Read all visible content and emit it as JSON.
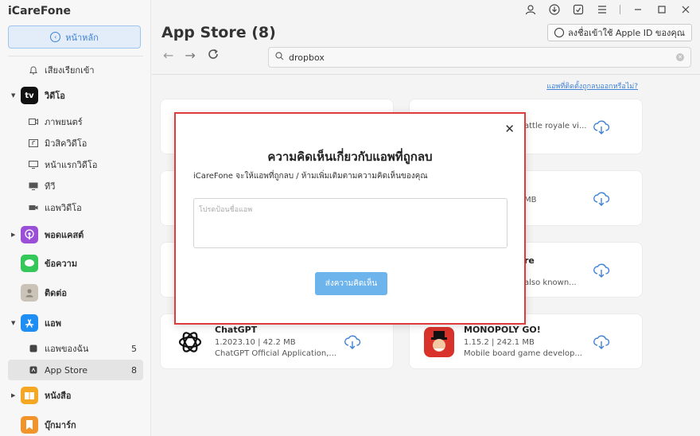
{
  "app": {
    "brand": "iCareFone"
  },
  "sidebar": {
    "home_label": "หน้าหลัก",
    "items": [
      {
        "label": "เสียงเรียกเข้า"
      },
      {
        "label": "วิดีโอ"
      },
      {
        "label": "ภาพยนตร์"
      },
      {
        "label": "มิวสิควิดีโอ"
      },
      {
        "label": "หน้าแรกวิดีโอ"
      },
      {
        "label": "ทีวี"
      },
      {
        "label": "แอพวิดีโอ"
      },
      {
        "label": "พอดแคสต์"
      },
      {
        "label": "ข้อความ"
      },
      {
        "label": "ติดต่อ"
      },
      {
        "label": "แอพ"
      },
      {
        "label": "แอพของฉัน",
        "count": "5"
      },
      {
        "label": "App Store",
        "count": "8"
      },
      {
        "label": "หนังสือ"
      },
      {
        "label": "บุ๊กมาร์ก"
      }
    ],
    "tv_badge": "tv"
  },
  "header": {
    "title": "App Store (8)",
    "apple_id_label": "ลงชื่อเข้าใช้ Apple ID ของคุณ"
  },
  "search": {
    "value": "dropbox"
  },
  "help_link": "แอพที่ติดตั้งถูกลบออกหรือไม่?",
  "cards": {
    "top_right_partial": "attle royale vi...",
    "mid_right_partial": "MB",
    "lower_right_name_partial": "re",
    "lower_right_desc_partial": "also known...",
    "chatgpt": {
      "name": "ChatGPT",
      "meta": "1.2023.10 | 42.2 MB",
      "desc": "ChatGPT Official Application,..."
    },
    "monopoly": {
      "name": "MONOPOLY GO!",
      "meta": "1.15.2 | 242.1 MB",
      "desc": "Mobile board game develop..."
    }
  },
  "modal": {
    "title": "ความคิดเห็นเกี่ยวกับแอพที่ถูกลบ",
    "subtitle": "iCareFone จะให้แอพที่ถูกลบ / ห้ามเพิ่มเติมตามความคิดเห็นของคุณ",
    "input_placeholder": "โปรดป้อนชื่อแอพ",
    "submit_label": "ส่งความคิดเห็น",
    "close_glyph": "✕"
  },
  "colors": {
    "accent": "#3f82d6",
    "modal_border": "#e03a3a",
    "submit": "#6db3ec"
  }
}
